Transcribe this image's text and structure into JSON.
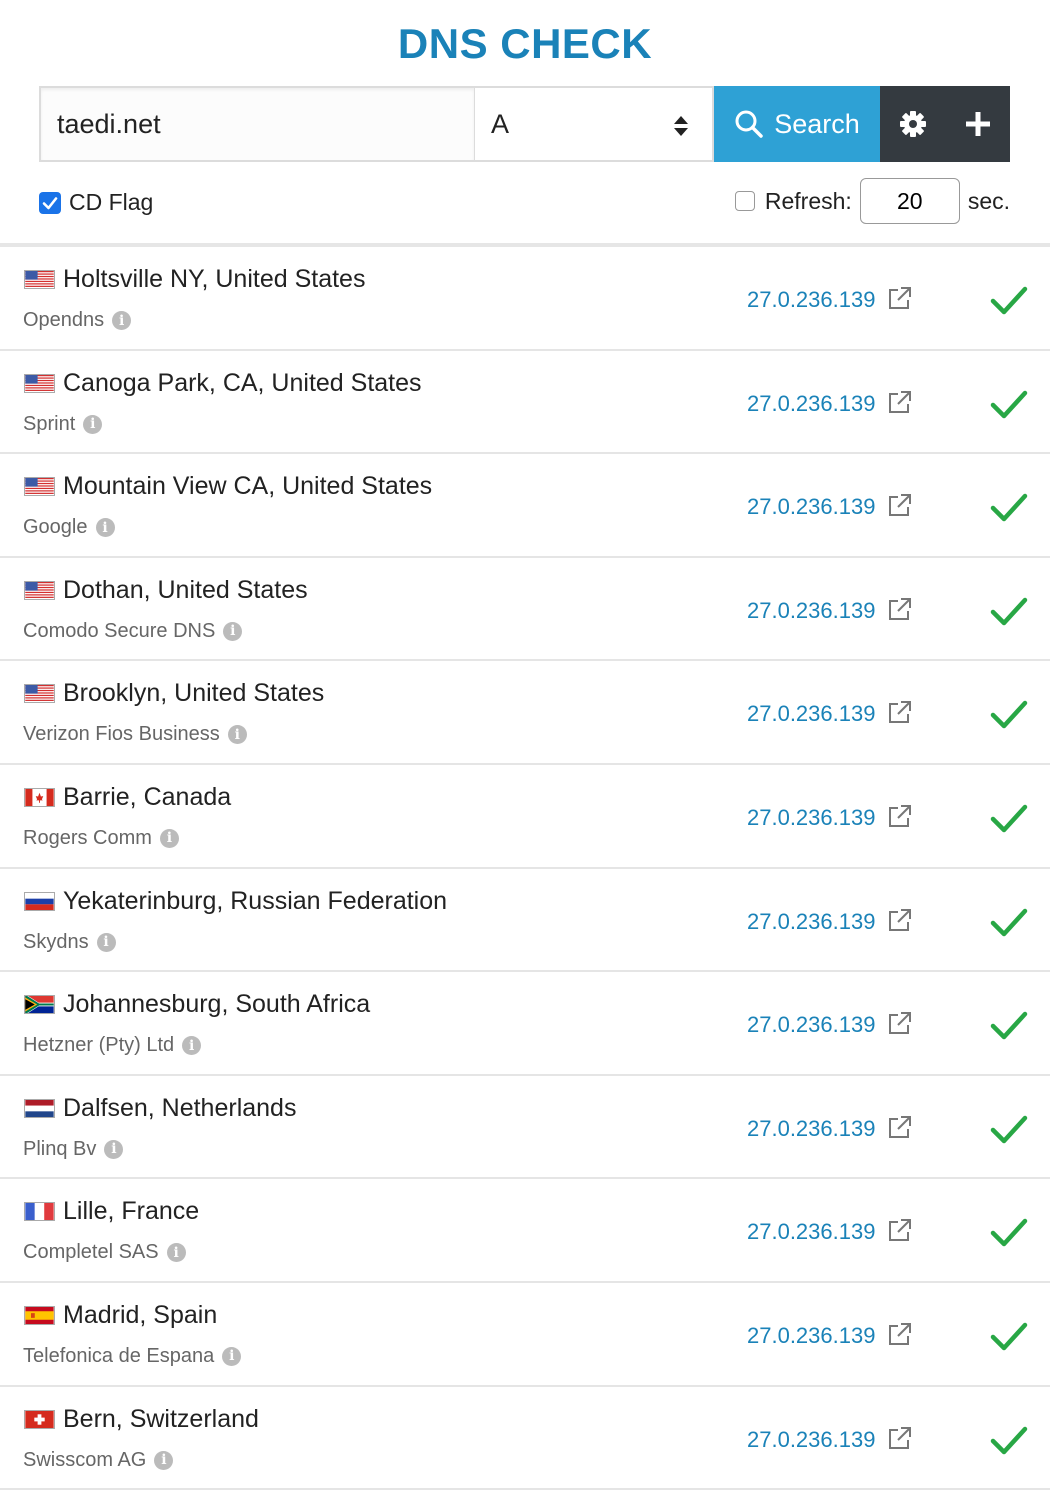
{
  "header": {
    "title": "DNS CHECK"
  },
  "search": {
    "domain_value": "taedi.net",
    "record_type": "A",
    "search_label": "Search"
  },
  "options": {
    "cd_flag_label": "CD Flag",
    "cd_flag_checked": true,
    "refresh_label": "Refresh:",
    "refresh_checked": false,
    "refresh_value": "20",
    "refresh_unit": "sec."
  },
  "colors": {
    "accent": "#1a82b8",
    "search_button": "#2ea1d5",
    "dark_button": "#343a40",
    "ok": "#28a745"
  },
  "results": [
    {
      "flag": "us",
      "location": "Holtsville NY, United States",
      "provider": "Opendns",
      "ip": "27.0.236.139",
      "status": "ok"
    },
    {
      "flag": "us",
      "location": "Canoga Park, CA, United States",
      "provider": "Sprint",
      "ip": "27.0.236.139",
      "status": "ok"
    },
    {
      "flag": "us",
      "location": "Mountain View CA, United States",
      "provider": "Google",
      "ip": "27.0.236.139",
      "status": "ok"
    },
    {
      "flag": "us",
      "location": "Dothan, United States",
      "provider": "Comodo Secure DNS",
      "ip": "27.0.236.139",
      "status": "ok"
    },
    {
      "flag": "us",
      "location": "Brooklyn, United States",
      "provider": "Verizon Fios Business",
      "ip": "27.0.236.139",
      "status": "ok"
    },
    {
      "flag": "ca",
      "location": "Barrie, Canada",
      "provider": "Rogers Comm",
      "ip": "27.0.236.139",
      "status": "ok"
    },
    {
      "flag": "ru",
      "location": "Yekaterinburg, Russian Federation",
      "provider": "Skydns",
      "ip": "27.0.236.139",
      "status": "ok"
    },
    {
      "flag": "za",
      "location": "Johannesburg, South Africa",
      "provider": "Hetzner (Pty) Ltd",
      "ip": "27.0.236.139",
      "status": "ok"
    },
    {
      "flag": "nl",
      "location": "Dalfsen, Netherlands",
      "provider": "Plinq Bv",
      "ip": "27.0.236.139",
      "status": "ok"
    },
    {
      "flag": "fr",
      "location": "Lille, France",
      "provider": "Completel SAS",
      "ip": "27.0.236.139",
      "status": "ok"
    },
    {
      "flag": "es",
      "location": "Madrid, Spain",
      "provider": "Telefonica de Espana",
      "ip": "27.0.236.139",
      "status": "ok"
    },
    {
      "flag": "ch",
      "location": "Bern, Switzerland",
      "provider": "Swisscom AG",
      "ip": "27.0.236.139",
      "status": "ok"
    }
  ]
}
